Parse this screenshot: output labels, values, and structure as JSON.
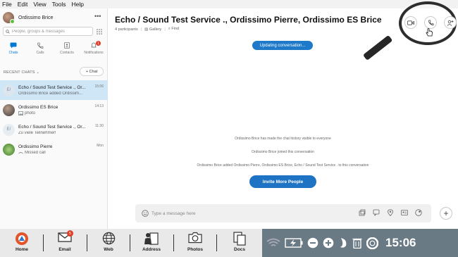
{
  "menubar": [
    "File",
    "Edit",
    "View",
    "Tools",
    "Help"
  ],
  "profile": {
    "name": "Ordissimo Brice"
  },
  "search": {
    "placeholder": "People, groups & messages"
  },
  "nav_tabs": [
    {
      "label": "Chats",
      "icon": "chat-icon",
      "active": true
    },
    {
      "label": "Calls",
      "icon": "phone-icon"
    },
    {
      "label": "Contacts",
      "icon": "contacts-icon"
    },
    {
      "label": "Notifications",
      "icon": "bell-icon",
      "badge": "1"
    }
  ],
  "recent_chats_label": "RECENT CHATS",
  "new_chat_label": "+ Chat",
  "chats": [
    {
      "name": "Echo / Sound Test Service ., Or...",
      "preview": "Ordissimo Brice added Ordissim...",
      "time": "15:06",
      "avatar": "E/",
      "active": true
    },
    {
      "name": "Ordissimo ES Brice",
      "preview": "photo",
      "time": "14:13",
      "avatar": "photo"
    },
    {
      "name": "Echo / Sound Test Service ., Or...",
      "preview": "Zu viele Teilnehmer!",
      "time": "11:30",
      "avatar": "E/"
    },
    {
      "name": "Ordissimo Pierre",
      "preview": "Missed call",
      "time": "Mon",
      "avatar": "photo-green"
    }
  ],
  "conversation": {
    "title": "Echo / Sound Test Service ., Ordissimo Pierre, Ordissimo ES Brice",
    "participants": "4 participants",
    "gallery": "Gallery",
    "find": "Find",
    "status_pill": "Updating conversation...",
    "system_messages": [
      "Ordissimo Brice has made the chat history visible to everyone",
      "Ordissimo Brice joined this conversation",
      "Ordissimo Brice added Ordissimo Pierre, Ordissimo ES Brice, Echo / Sound Test Service . to this conversation"
    ],
    "invite_button": "Invite More People"
  },
  "composer": {
    "placeholder": "Type a message here"
  },
  "taskbar": {
    "items": [
      {
        "label": "Home",
        "icon": "home-icon"
      },
      {
        "label": "Email",
        "icon": "email-icon",
        "badge": "5"
      },
      {
        "label": "Web",
        "icon": "globe-icon"
      },
      {
        "label": "Address",
        "icon": "address-book-icon"
      },
      {
        "label": "Photos",
        "icon": "camera-icon"
      },
      {
        "label": "Docs",
        "icon": "docs-icon"
      }
    ],
    "clock": "15:06"
  },
  "colors": {
    "accent": "#1e73c4",
    "selected_chat": "#cfe6f7",
    "tray": "#6a7a85"
  }
}
